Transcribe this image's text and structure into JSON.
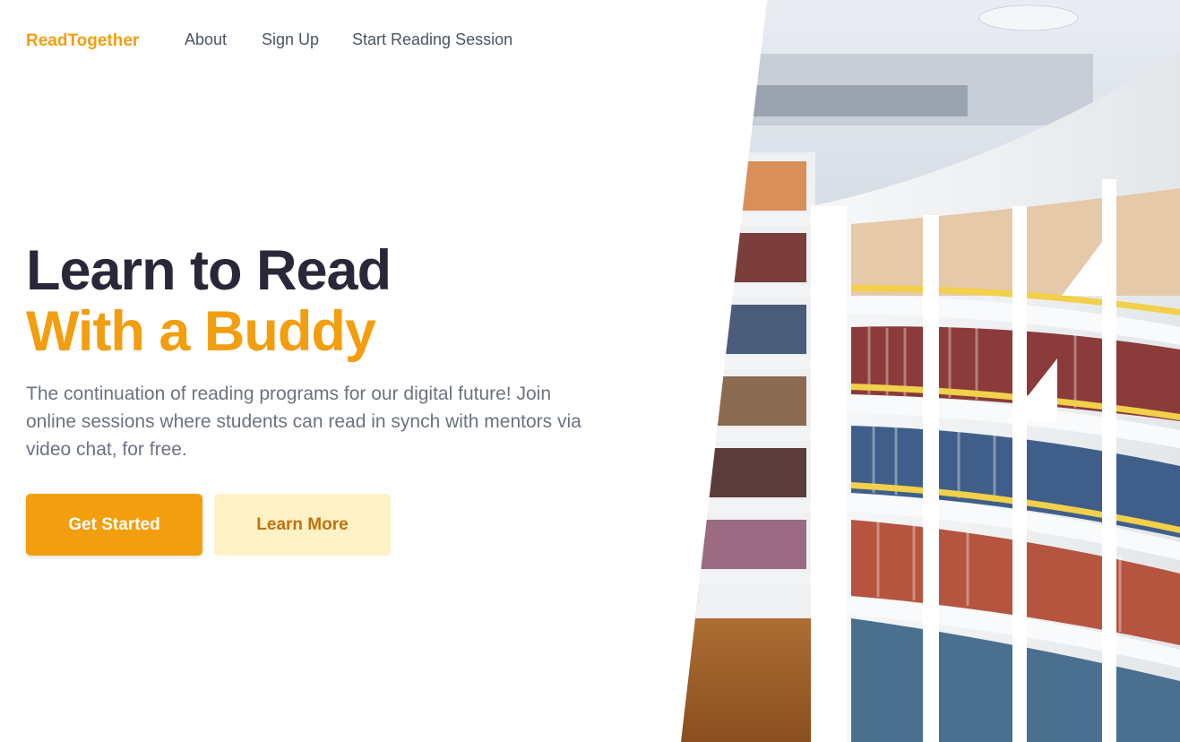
{
  "nav": {
    "brand": "ReadTogether",
    "links": [
      "About",
      "Sign Up",
      "Start Reading Session"
    ]
  },
  "hero": {
    "title_line1": "Learn to Read",
    "title_line2": "With a Buddy",
    "description": "The continuation of reading programs for our digital future! Join online sessions where students can read in synch with mentors via video chat, for free.",
    "primary_button": "Get Started",
    "secondary_button": "Learn More"
  },
  "colors": {
    "accent": "#f29e0f",
    "heading_dark": "#2a2838",
    "body_text": "#6b7280",
    "secondary_button_bg": "#fdf1c6"
  },
  "image": {
    "subject": "library-bookshelves-photo"
  }
}
